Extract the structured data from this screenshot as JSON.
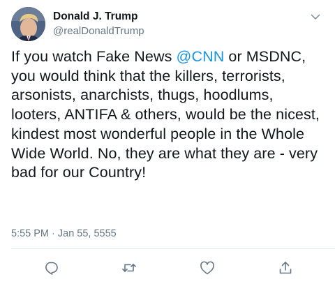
{
  "user": {
    "display_name": "Donald J. Trump",
    "handle": "@realDonaldTrump"
  },
  "tweet": {
    "text_before": "If you watch Fake News ",
    "mention": "@CNN",
    "text_after": " or MSDNC, you would think that the killers, terrorists, arsonists, anarchists, thugs, hoodlums, looters, ANTIFA & others, would be the nicest, kindest most wonderful people in the Whole Wide World. No, they are what they are - very bad for our Country!",
    "timestamp": "5:55 PM · Jan 55, 5555"
  },
  "actions": {
    "reply_icon": "reply-icon",
    "retweet_icon": "retweet-icon",
    "like_icon": "like-icon",
    "share_icon": "share-icon"
  },
  "colors": {
    "link": "#1b95e0",
    "text": "#14171a",
    "muted": "#657786",
    "divider": "#e6ecf0"
  }
}
